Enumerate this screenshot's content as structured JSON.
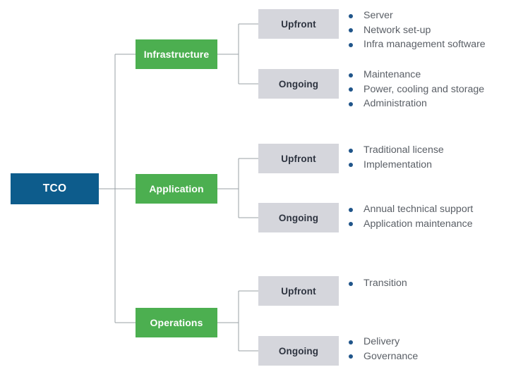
{
  "diagram": {
    "title_node": {
      "label": "TCO"
    },
    "colors": {
      "root_box": "#0d5c8c",
      "category_box": "#4caf50",
      "phase_box": "#d5d6dc",
      "bullet_dot": "#20558a",
      "bullet_text": "#5a5f66",
      "connector_line": "#9aa0a6",
      "phase_text": "#2e3440",
      "box_text": "#ffffff",
      "background": "#ffffff"
    },
    "branches": [
      {
        "label": "Infrastructure",
        "phases": [
          {
            "label": "Upfront",
            "items": [
              "Server",
              "Network set-up",
              "Infra management software"
            ]
          },
          {
            "label": "Ongoing",
            "items": [
              "Maintenance",
              "Power, cooling and storage",
              "Administration"
            ]
          }
        ]
      },
      {
        "label": "Application",
        "phases": [
          {
            "label": "Upfront",
            "items": [
              "Traditional license",
              "Implementation"
            ]
          },
          {
            "label": "Ongoing",
            "items": [
              "Annual technical support",
              "Application maintenance"
            ]
          }
        ]
      },
      {
        "label": "Operations",
        "phases": [
          {
            "label": "Upfront",
            "items": [
              "Transition"
            ]
          },
          {
            "label": "Ongoing",
            "items": [
              "Delivery",
              "Governance"
            ]
          }
        ]
      }
    ]
  }
}
